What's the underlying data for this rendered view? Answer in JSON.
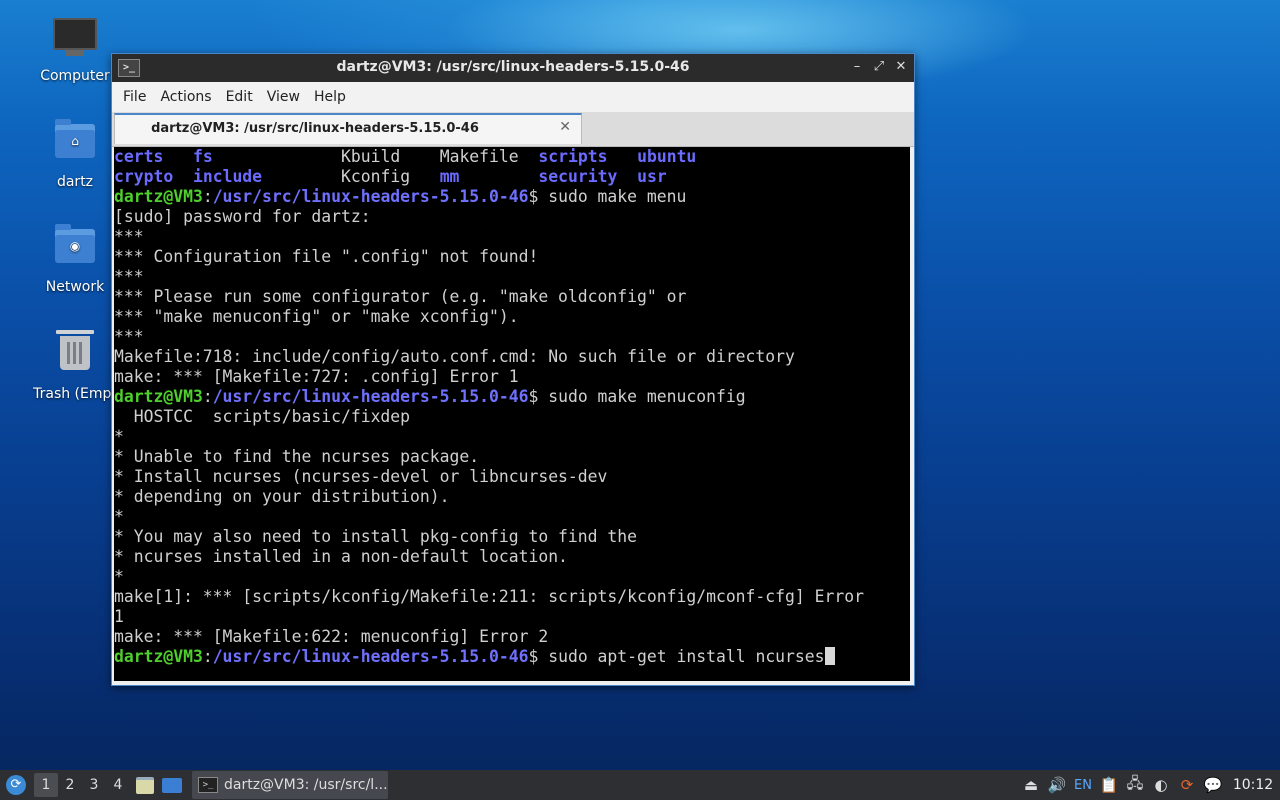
{
  "desktop": {
    "icons": [
      {
        "label": "Computer"
      },
      {
        "label": "dartz"
      },
      {
        "label": "Network"
      },
      {
        "label": "Trash (Empt"
      }
    ]
  },
  "window": {
    "title": "dartz@VM3: /usr/src/linux-headers-5.15.0-46",
    "controls": {
      "minimize": "–",
      "maximize": "⤢",
      "close": "✕"
    },
    "menu": [
      "File",
      "Actions",
      "Edit",
      "View",
      "Help"
    ],
    "tab": {
      "label": "dartz@VM3: /usr/src/linux-headers-5.15.0-46",
      "close": "✕"
    }
  },
  "terminal": {
    "ls_rows": [
      [
        "certs",
        "fs",
        "Kbuild",
        "Makefile",
        "scripts",
        "ubuntu"
      ],
      [
        "crypto",
        "include",
        "Kconfig",
        "mm",
        "security",
        "usr"
      ]
    ],
    "prompt_user": "dartz@VM3",
    "prompt_sep": ":",
    "prompt_path": "/usr/src/linux-headers-5.15.0-46",
    "prompt_end": "$ ",
    "commands": [
      "sudo make menu",
      "sudo make menuconfig",
      "sudo apt-get install ncurses"
    ],
    "output1": [
      "[sudo] password for dartz:",
      "***",
      "*** Configuration file \".config\" not found!",
      "***",
      "*** Please run some configurator (e.g. \"make oldconfig\" or",
      "*** \"make menuconfig\" or \"make xconfig\").",
      "***",
      "Makefile:718: include/config/auto.conf.cmd: No such file or directory",
      "make: *** [Makefile:727: .config] Error 1"
    ],
    "output2": [
      "  HOSTCC  scripts/basic/fixdep",
      "*",
      "* Unable to find the ncurses package.",
      "* Install ncurses (ncurses-devel or libncurses-dev",
      "* depending on your distribution).",
      "*",
      "* You may also need to install pkg-config to find the",
      "* ncurses installed in a non-default location.",
      "*",
      "make[1]: *** [scripts/kconfig/Makefile:211: scripts/kconfig/mconf-cfg] Error",
      "1",
      "make: *** [Makefile:622: menuconfig] Error 2"
    ]
  },
  "taskbar": {
    "workspaces": [
      "1",
      "2",
      "3",
      "4"
    ],
    "active_workspace": "1",
    "task_label": "dartz@VM3: /usr/src/l...",
    "lang": "EN",
    "clock": "10:12"
  },
  "colors": {
    "dir": "#6b6bff",
    "prompt_user": "#4ecf2c",
    "prompt_path": "#7070ff"
  }
}
